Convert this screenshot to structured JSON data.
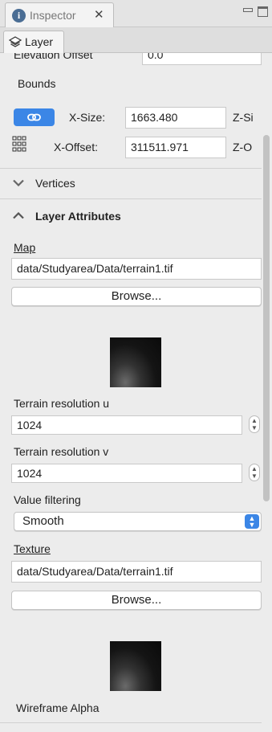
{
  "window": {
    "tab_title": "Inspector",
    "info_icon_glyph": "i",
    "close_glyph": "✕",
    "subtab_label": "Layer"
  },
  "form": {
    "elevation_offset_label": "Elevation Offset",
    "elevation_offset_value": "0.0",
    "bounds_label": "Bounds",
    "x_size_label": "X-Size:",
    "x_size_value": "1663.480",
    "z_size_label": "Z-Si",
    "x_offset_label": "X-Offset:",
    "x_offset_value": "311511.971",
    "z_offset_label": "Z-O",
    "vertices_header": "Vertices",
    "layer_attributes_header": "Layer Attributes",
    "map_label": "Map",
    "map_path": "data/Studyarea/Data/terrain1.tif",
    "browse_label": "Browse...",
    "terrain_res_u_label": "Terrain resolution u",
    "terrain_res_u_value": "1024",
    "terrain_res_v_label": "Terrain resolution v",
    "terrain_res_v_value": "1024",
    "value_filtering_label": "Value filtering",
    "value_filtering_selected": "Smooth",
    "texture_label": "Texture",
    "texture_path": "data/Studyarea/Data/terrain1.tif",
    "texture_browse_label": "Browse...",
    "wireframe_alpha_label": "Wireframe Alpha"
  },
  "colors": {
    "accent": "#3b86e6",
    "info_icon": "#4a6d94"
  }
}
